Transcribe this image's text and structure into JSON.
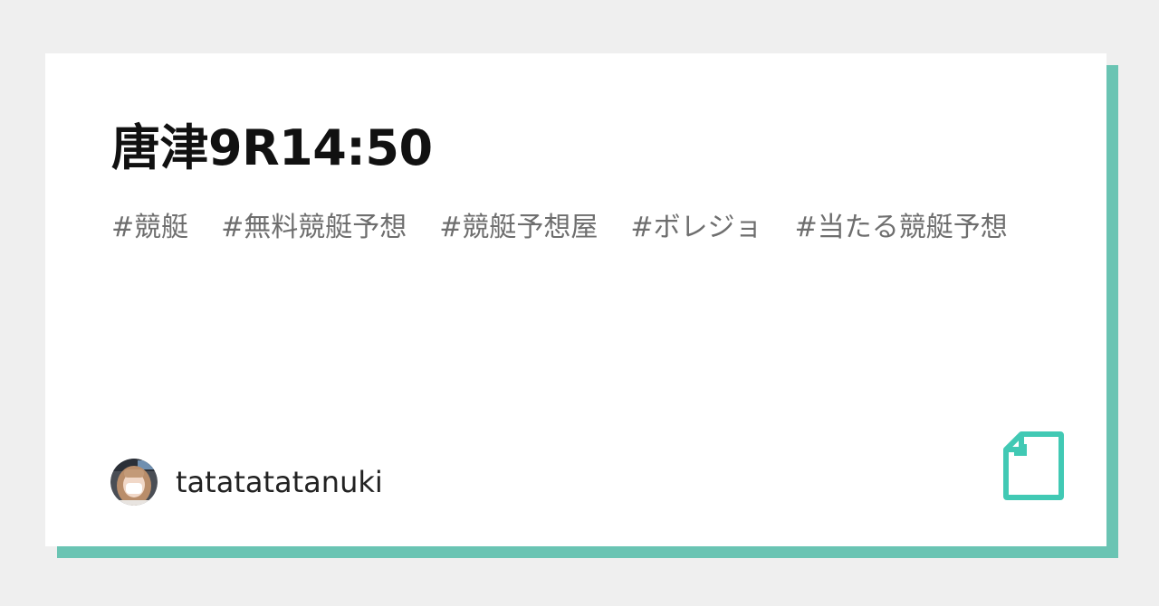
{
  "card": {
    "title": "唐津9R14:50",
    "tags": [
      "#競艇",
      "#無料競艇予想",
      "#競艇予想屋",
      "#ボレジョ",
      "#当たる競艇予想"
    ]
  },
  "author": {
    "name": "tatatatatanuki",
    "avatar_icon": "user-avatar"
  },
  "brand": {
    "icon": "note-document-icon",
    "accent_color": "#6ac4b3",
    "icon_color": "#41c9b4"
  }
}
